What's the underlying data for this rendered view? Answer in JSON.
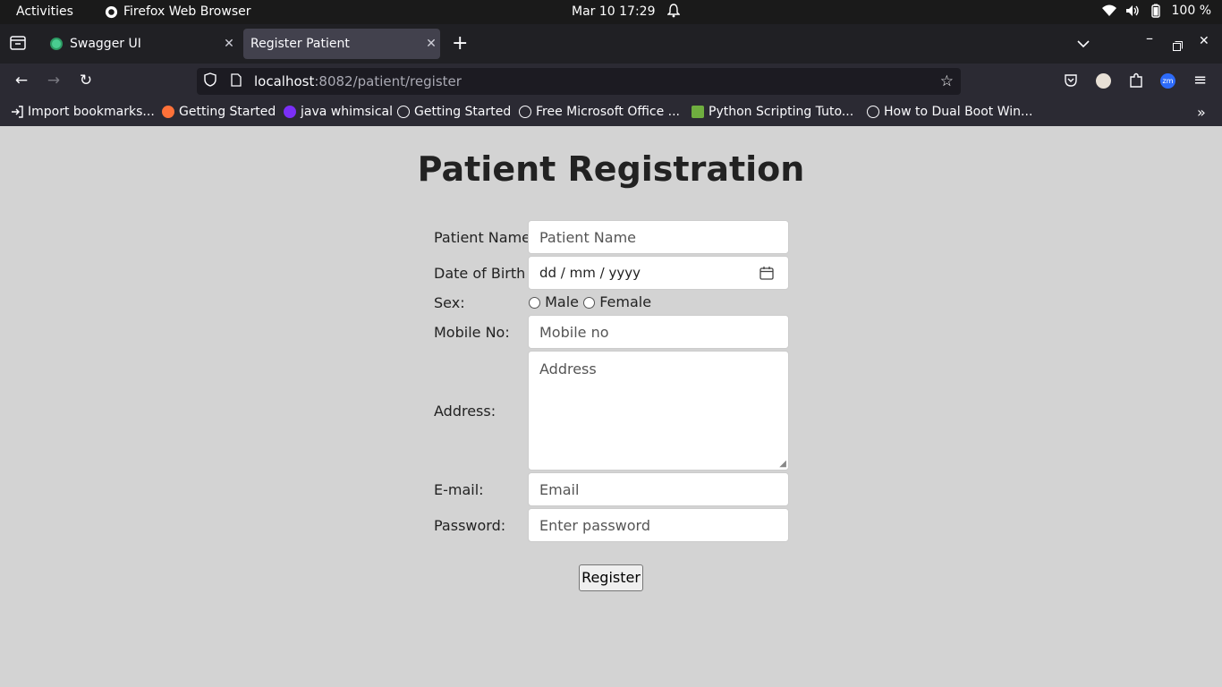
{
  "system": {
    "activities": "Activities",
    "app_name": "Firefox Web Browser",
    "clock": "Mar 10  17:29",
    "battery": "100 %"
  },
  "tabs": [
    {
      "label": "Swagger UI",
      "active": false
    },
    {
      "label": "Register Patient",
      "active": true
    }
  ],
  "nav": {
    "url_host": "localhost",
    "url_rest": ":8082/patient/register"
  },
  "bookmarks": [
    {
      "label": "Import bookmarks...",
      "icon": "import-icon"
    },
    {
      "label": "Getting Started",
      "icon": "firefox-icon"
    },
    {
      "label": "java whimsical",
      "icon": "whimsical-icon"
    },
    {
      "label": "Getting Started",
      "icon": "globe-icon"
    },
    {
      "label": "Free Microsoft Office ...",
      "icon": "globe-icon"
    },
    {
      "label": "Python Scripting Tuto...",
      "icon": "python-icon"
    },
    {
      "label": "How to Dual Boot Win...",
      "icon": "globe-icon"
    }
  ],
  "form": {
    "title": "Patient Registration",
    "name_label": "Patient Name:",
    "name_placeholder": "Patient Name",
    "dob_label": "Date of Birth",
    "dob_placeholder": "dd / mm / yyyy",
    "sex_label": "Sex:",
    "sex_male": "Male",
    "sex_female": "Female",
    "mobile_label": "Mobile No:",
    "mobile_placeholder": "Mobile no",
    "address_label": "Address:",
    "address_placeholder": "Address",
    "email_label": "E-mail:",
    "email_placeholder": "Email",
    "password_label": "Password:",
    "password_placeholder": "Enter password",
    "submit_label": "Register"
  },
  "colors": {
    "page_bg": "#d3d3d3",
    "topbar_bg": "#1a1a1a",
    "tabstrip_bg": "#202024",
    "toolbar_bg": "#2b2a33"
  }
}
